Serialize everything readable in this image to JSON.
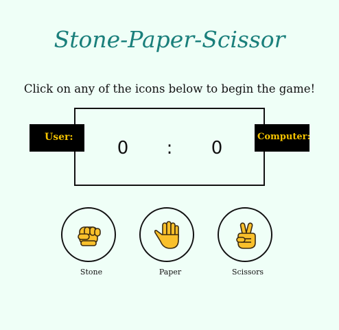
{
  "header": {
    "title": "Stone-Paper-Scissor",
    "instruction": "Click on any of the icons below to begin the game!"
  },
  "scoreboard": {
    "user_label": "User:",
    "computer_label": "Computer:",
    "user_score": "0",
    "separator": ":",
    "computer_score": "0"
  },
  "choices": [
    {
      "label": "Stone",
      "icon": "fist-icon"
    },
    {
      "label": "Paper",
      "icon": "raised-hand-icon"
    },
    {
      "label": "Scissors",
      "icon": "victory-hand-icon"
    }
  ],
  "colors": {
    "background": "#effff7",
    "title": "#1a7f7b",
    "badge_background": "#000000",
    "badge_text": "#f5c400",
    "emoji_yellow": "#f9c02b"
  }
}
